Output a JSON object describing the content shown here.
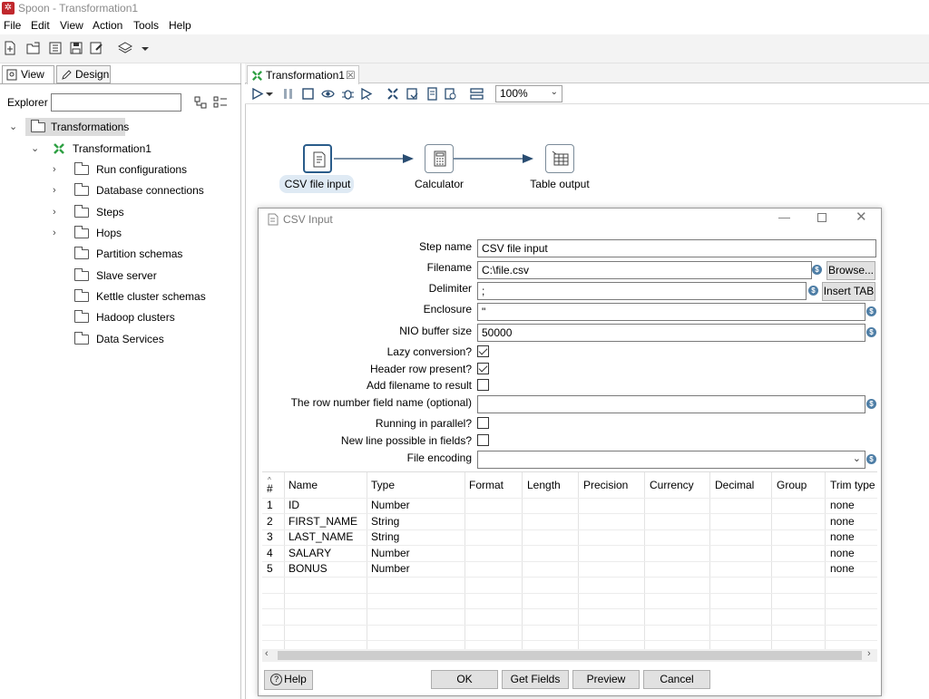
{
  "window": {
    "title": "Spoon - Transformation1"
  },
  "menu": [
    "File",
    "Edit",
    "View",
    "Action",
    "Tools",
    "Help"
  ],
  "left_tabs": {
    "view": "View",
    "design": "Design"
  },
  "explorer": {
    "label": "Explorer",
    "value": ""
  },
  "tree": {
    "root": "Transformations",
    "transformation": "Transformation1",
    "items": [
      "Run configurations",
      "Database connections",
      "Steps",
      "Hops",
      "Partition schemas",
      "Slave server",
      "Kettle cluster schemas",
      "Hadoop clusters",
      "Data Services"
    ]
  },
  "editor_tab": {
    "label": "Transformation1"
  },
  "zoom": {
    "value": "100%"
  },
  "steps": [
    "CSV file input",
    "Calculator",
    "Table output"
  ],
  "dialog": {
    "title": "CSV Input",
    "labels": {
      "step_name": "Step name",
      "filename": "Filename",
      "delimiter": "Delimiter",
      "enclosure": "Enclosure",
      "nio_buffer": "NIO buffer size",
      "lazy": "Lazy conversion?",
      "header": "Header row present?",
      "add_filename": "Add filename to result",
      "row_number": "The row number field name (optional)",
      "parallel": "Running in parallel?",
      "newline": "New line possible in fields?",
      "encoding": "File encoding"
    },
    "values": {
      "step_name": "CSV file input",
      "filename": "C:\\file.csv",
      "delimiter": ";",
      "enclosure": "\"",
      "nio_buffer": "50000",
      "row_number": "",
      "encoding": ""
    },
    "buttons": {
      "browse": "Browse...",
      "insert_tab": "Insert TAB",
      "help": "Help",
      "ok": "OK",
      "get_fields": "Get Fields",
      "preview": "Preview",
      "cancel": "Cancel"
    },
    "grid": {
      "headers": [
        "#",
        "Name",
        "Type",
        "Format",
        "Length",
        "Precision",
        "Currency",
        "Decimal",
        "Group",
        "Trim type"
      ],
      "rows": [
        {
          "n": "1",
          "name": "ID",
          "type": "Number",
          "trim": "none"
        },
        {
          "n": "2",
          "name": "FIRST_NAME",
          "type": "String",
          "trim": "none"
        },
        {
          "n": "3",
          "name": "LAST_NAME",
          "type": "String",
          "trim": "none"
        },
        {
          "n": "4",
          "name": "SALARY",
          "type": "Number",
          "trim": "none"
        },
        {
          "n": "5",
          "name": "BONUS",
          "type": "Number",
          "trim": "none"
        }
      ]
    }
  }
}
